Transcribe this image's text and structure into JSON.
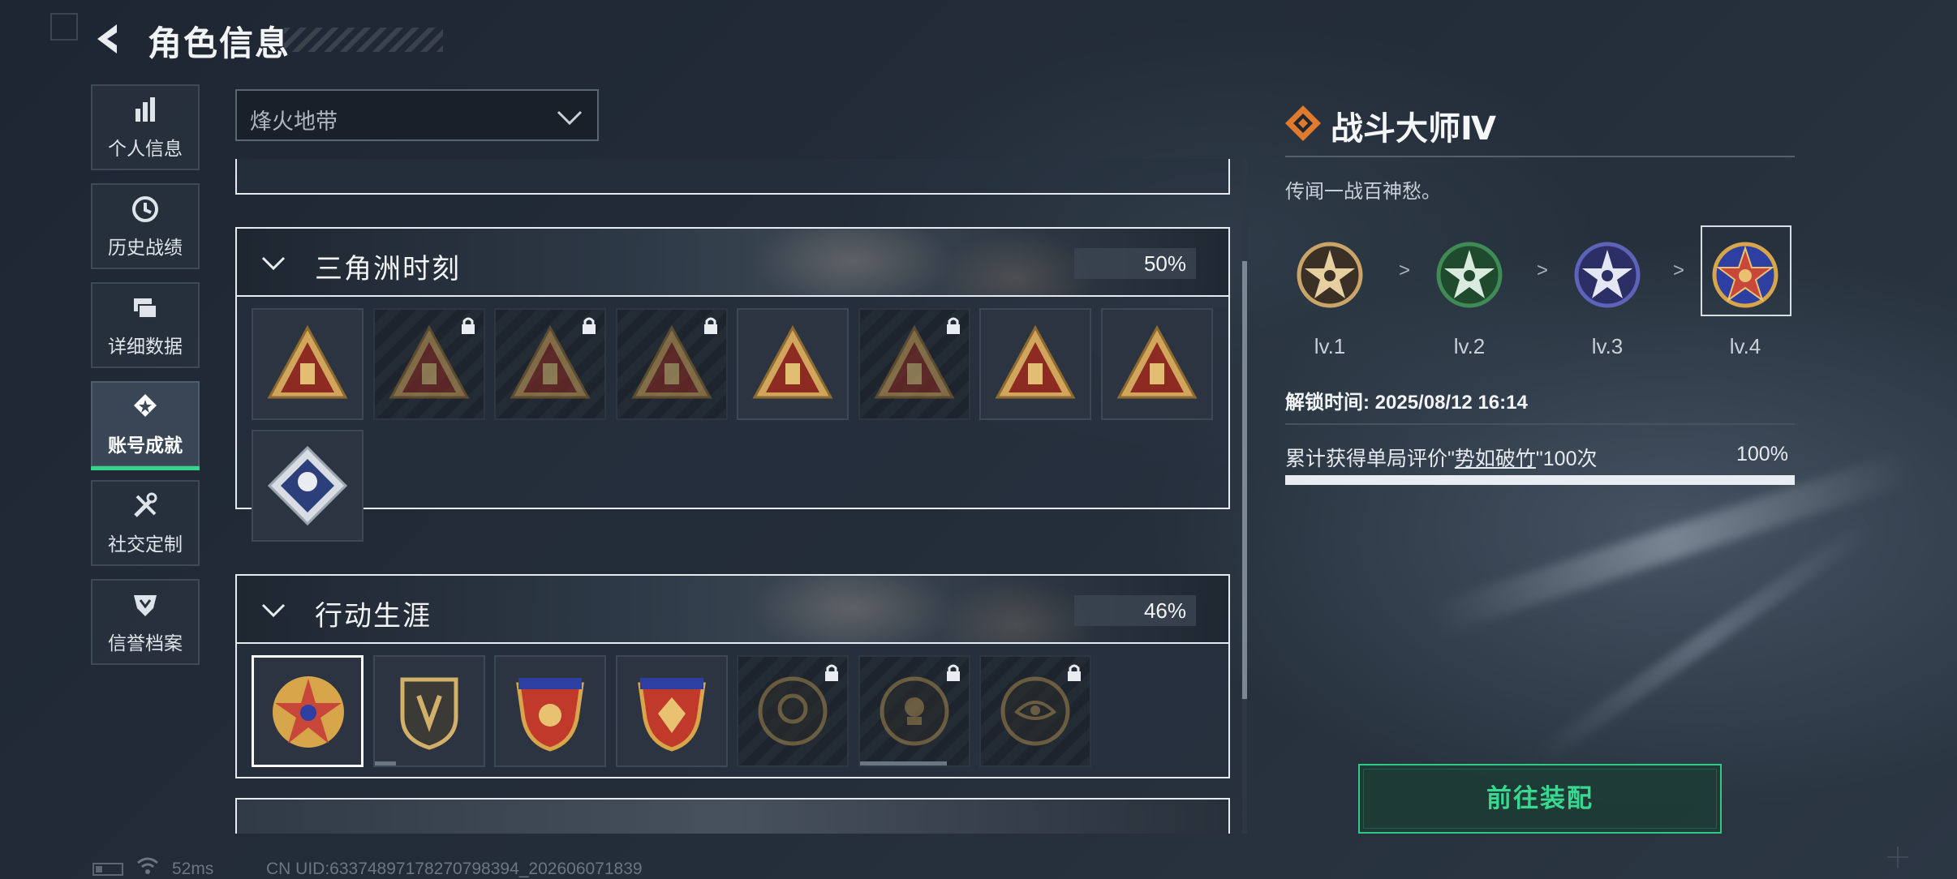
{
  "header": {
    "title": "角色信息"
  },
  "nav": {
    "items": [
      {
        "label": "个人信息",
        "icon": "bar-chart-icon"
      },
      {
        "label": "历史战绩",
        "icon": "history-clock-icon"
      },
      {
        "label": "详细数据",
        "icon": "data-cards-icon"
      },
      {
        "label": "账号成就",
        "icon": "achievement-medal-icon",
        "active": true
      },
      {
        "label": "社交定制",
        "icon": "tools-icon"
      },
      {
        "label": "信誉档案",
        "icon": "reputation-shield-icon"
      }
    ]
  },
  "filter": {
    "selected": "烽火地带"
  },
  "sections": [
    {
      "title": "三角洲时刻",
      "percent": "50%",
      "badges": [
        {
          "locked": false
        },
        {
          "locked": true
        },
        {
          "locked": true
        },
        {
          "locked": true
        },
        {
          "locked": false
        },
        {
          "locked": true
        },
        {
          "locked": false
        },
        {
          "locked": false
        },
        {
          "locked": false
        }
      ]
    },
    {
      "title": "行动生涯",
      "percent": "46%",
      "badges": [
        {
          "locked": false,
          "selected": true
        },
        {
          "locked": false,
          "progress": 0.2
        },
        {
          "locked": false
        },
        {
          "locked": false
        },
        {
          "locked": true
        },
        {
          "locked": true,
          "progress": 0.8
        },
        {
          "locked": true
        }
      ]
    }
  ],
  "detail": {
    "title": "战斗大师Ⅳ",
    "description": "传闻一战百神愁。",
    "levels": [
      {
        "label": "lv.1",
        "color": "#caa56a"
      },
      {
        "label": "lv.2",
        "color": "#3f8a55"
      },
      {
        "label": "lv.3",
        "color": "#5d63b8"
      },
      {
        "label": "lv.4",
        "color": "#c8463a"
      }
    ],
    "level_arrow": ">",
    "unlock_time": "解锁时间: 2025/08/12 16:14",
    "requirement_prefix": "累计获得单局评价\"",
    "requirement_link": "势如破竹",
    "requirement_suffix": "\"100次",
    "requirement_percent": "100%",
    "requirement_progress": 1.0
  },
  "equip_button": "前往装配",
  "status": {
    "ping": "52ms",
    "uid": "CN UID:63374897178270798394_202606071839"
  },
  "colors": {
    "accent": "#35d38b",
    "gold": "#c9a25c",
    "red_badge": "#9e2b22"
  }
}
